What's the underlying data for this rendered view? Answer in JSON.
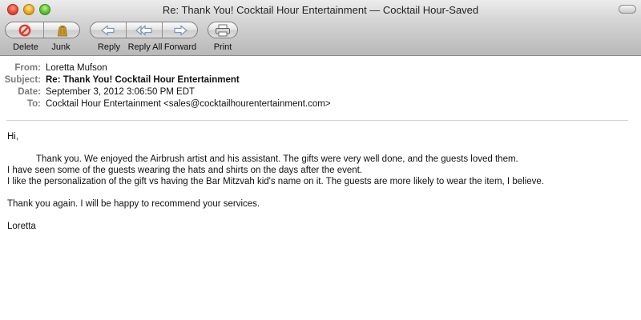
{
  "window": {
    "title": "Re: Thank You! Cocktail Hour Entertainment — Cocktail Hour-Saved"
  },
  "toolbar": {
    "delete_label": "Delete",
    "junk_label": "Junk",
    "reply_label": "Reply",
    "reply_all_label": "Reply All",
    "forward_label": "Forward",
    "print_label": "Print"
  },
  "headers": {
    "from_key": "From:",
    "from_value": "Loretta Mufson",
    "subject_key": "Subject:",
    "subject_value": "Re: Thank You! Cocktail Hour Entertainment",
    "date_key": "Date:",
    "date_value": "September 3, 2012 3:06:50 PM EDT",
    "to_key": "To:",
    "to_value": "Cocktail Hour Entertainment <sales@cocktailhourentertainment.com>"
  },
  "message": {
    "greeting": "Hi,",
    "line1": "Thank you.  We enjoyed the Airbrush artist and his assistant.  The gifts were very well done, and the guests loved them.",
    "line2": "I have seen some of the guests wearing the hats and shirts on the days after the event.",
    "line3": "I like the personalization of the gift vs having the Bar Mitzvah kid's name on it.  The guests are more likely to wear the item, I believe.",
    "line4": "Thank you again.  I will be happy to recommend your services.",
    "signature": "Loretta"
  },
  "colors": {
    "delete_icon": "#e03a2a",
    "junk_icon": "#c99a2e",
    "arrow_icon": "#6f8fb8",
    "header_key": "#7a7a7a"
  }
}
